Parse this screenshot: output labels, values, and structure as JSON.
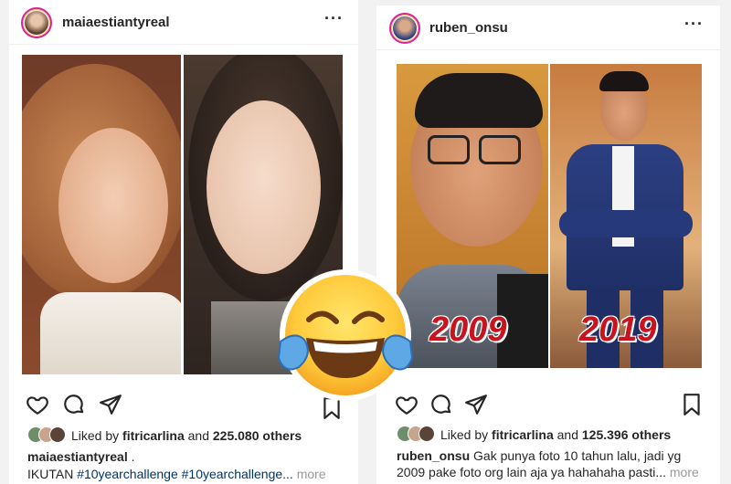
{
  "posts": [
    {
      "username": "maiaestiantyreal",
      "menu_icon": "ellipsis-icon",
      "likes": {
        "prefix": "Liked by",
        "user": "fitricarlina",
        "and": "and",
        "count": "225.080 others"
      },
      "caption": {
        "user": "maiaestiantyreal",
        "text": " .",
        "line2_text": "IKUTAN",
        "hashtags": "#10yearchallenge #10yearchallenge...",
        "more": "more"
      }
    },
    {
      "username": "ruben_onsu",
      "menu_icon": "ellipsis-icon",
      "photo_labels": [
        "2009",
        "2019"
      ],
      "likes": {
        "prefix": "Liked by",
        "user": "fitricarlina",
        "and": "and",
        "count": "125.396 others"
      },
      "caption": {
        "user": "ruben_onsu",
        "text": " Gak punya foto 10 tahun lalu, jadi yg",
        "line2_text": "2009 pake foto org lain aja ya hahahaha pasti...",
        "more": "more"
      }
    }
  ],
  "icons": [
    "heart-icon",
    "comment-icon",
    "share-icon",
    "bookmark-icon",
    "tears-of-joy-emoji"
  ],
  "colors": {
    "text": "#262626",
    "hashtag": "#003569",
    "muted": "#999999",
    "year_label": "#c8141e"
  }
}
